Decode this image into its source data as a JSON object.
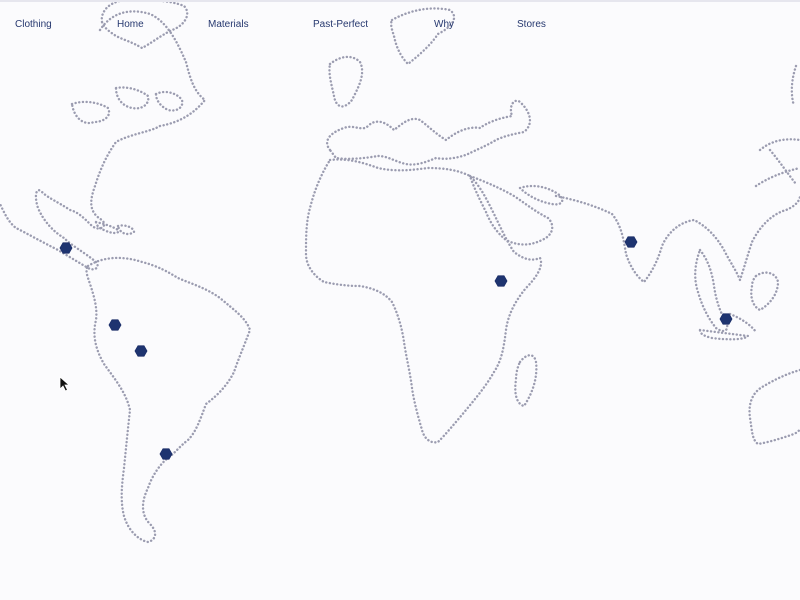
{
  "nav": {
    "items": [
      {
        "label": "Clothing"
      },
      {
        "label": "Home"
      },
      {
        "label": "Materials"
      },
      {
        "label": "Past-Perfect"
      },
      {
        "label": "Why"
      },
      {
        "label": "Stores"
      }
    ]
  },
  "map": {
    "style": "dotted-outline world map",
    "outline_color": "#9b9cb0",
    "background_color": "#fbfbfd",
    "marker_color": "#1e3470",
    "marker_shape": "hexagon",
    "marker_count": 8
  },
  "icons": {
    "pointer": "mouse-pointer-icon"
  }
}
